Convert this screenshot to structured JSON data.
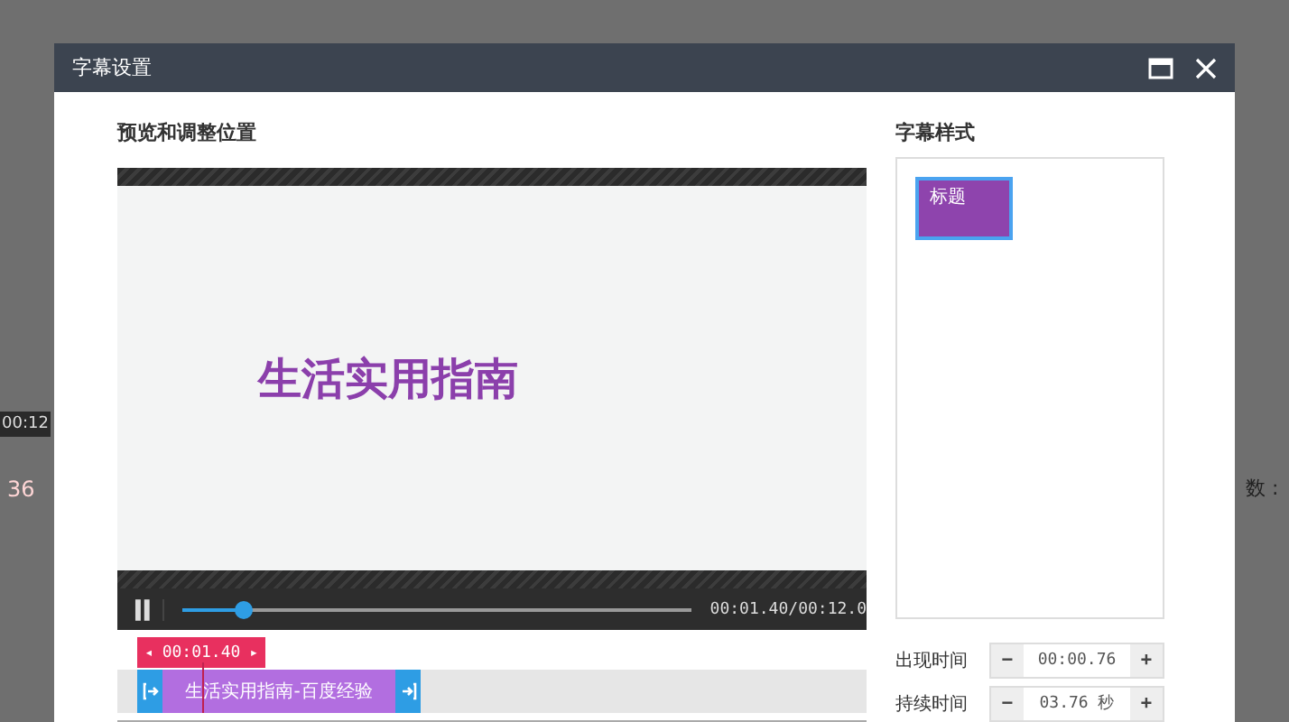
{
  "background": {
    "texts": [
      "00:12",
      "36",
      "数 :"
    ]
  },
  "window": {
    "title": "字幕设置"
  },
  "preview": {
    "heading": "预览和调整位置",
    "caption": "生活实用指南",
    "playing": true,
    "level": 0.12,
    "time": "00:01.40/00:12.0"
  },
  "timeline": {
    "playhead": {
      "prev": "◂",
      "time": "00:01.40",
      "next": "▸"
    },
    "clip": {
      "text": "生活实用指南-百度经验"
    }
  },
  "styles": {
    "heading": "字幕样式",
    "items": [
      {
        "label": "标题",
        "selected": true
      }
    ]
  },
  "fields": [
    {
      "label": "出现时间",
      "minus": "−",
      "value": "00:00.76",
      "plus": "+"
    },
    {
      "label": "持续时间",
      "minus": "−",
      "value": "03.76 秒",
      "plus": "+"
    }
  ]
}
